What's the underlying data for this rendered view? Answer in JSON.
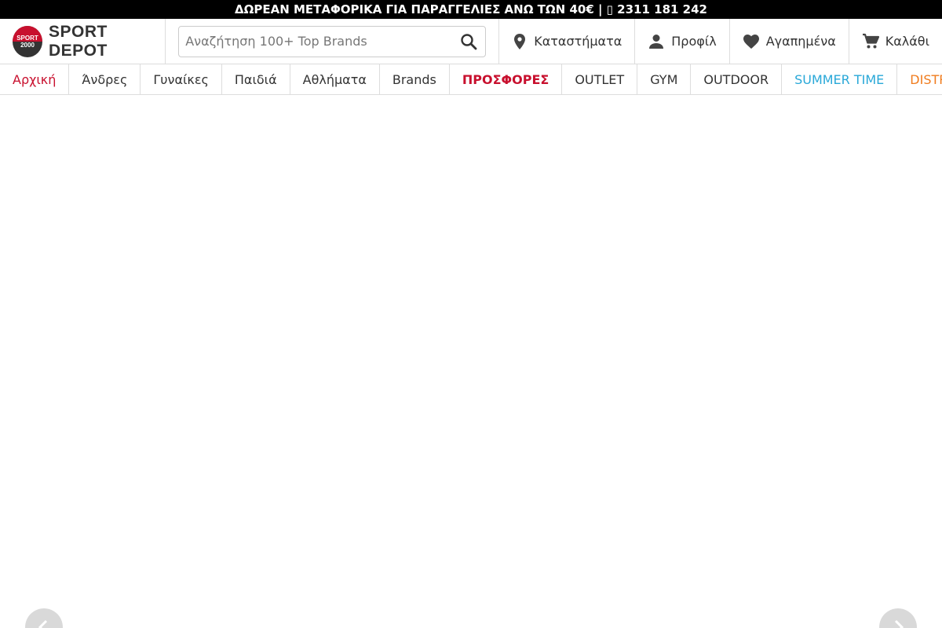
{
  "topbar": {
    "text": "ΔΩΡΕΑΝ ΜΕΤΑΦΟΡΙΚΑ ΓΙΑ ΠΑΡΑΓΓΕΛΙΕΣ ΑΝΩ ΤΩΝ 40€ | ▯ 2311 181 242"
  },
  "logo": {
    "badge_top": "SPORT",
    "badge_bottom": "2000",
    "text": "SPORT DEPOT"
  },
  "search": {
    "placeholder": "Αναζήτηση 100+ Top Brands",
    "value": ""
  },
  "header": {
    "stores_label": "Καταστήματα",
    "profile_label": "Προφίλ",
    "wishlist_label": "Αγαπημένα",
    "cart_label": "Καλάθι"
  },
  "nav": {
    "items": [
      {
        "label": "Αρχική",
        "color": "#c8102e"
      },
      {
        "label": "Άνδρες",
        "color": "#333333"
      },
      {
        "label": "Γυναίκες",
        "color": "#333333"
      },
      {
        "label": "Παιδιά",
        "color": "#333333"
      },
      {
        "label": "Αθλήματα",
        "color": "#333333"
      },
      {
        "label": "Brands",
        "color": "#333333"
      },
      {
        "label": "ΠΡΟΣΦΟΡΕΣ",
        "color": "#c8102e"
      },
      {
        "label": "OUTLET",
        "color": "#333333"
      },
      {
        "label": "GYM",
        "color": "#333333"
      },
      {
        "label": "OUTDOOR",
        "color": "#333333"
      },
      {
        "label": "SUMMER TIME",
        "color": "#29a8d8"
      },
      {
        "label": "DISTRICT",
        "color": "#f07c1e"
      }
    ]
  },
  "colors": {
    "accent": "#c8102e",
    "topbar_bg": "#000000",
    "text": "#333333"
  },
  "icons": {
    "stores": "location-pin-icon",
    "profile": "person-icon",
    "wishlist": "heart-icon",
    "cart": "cart-icon",
    "search": "search-icon",
    "prev": "chevron-left-icon",
    "next": "chevron-right-icon"
  }
}
